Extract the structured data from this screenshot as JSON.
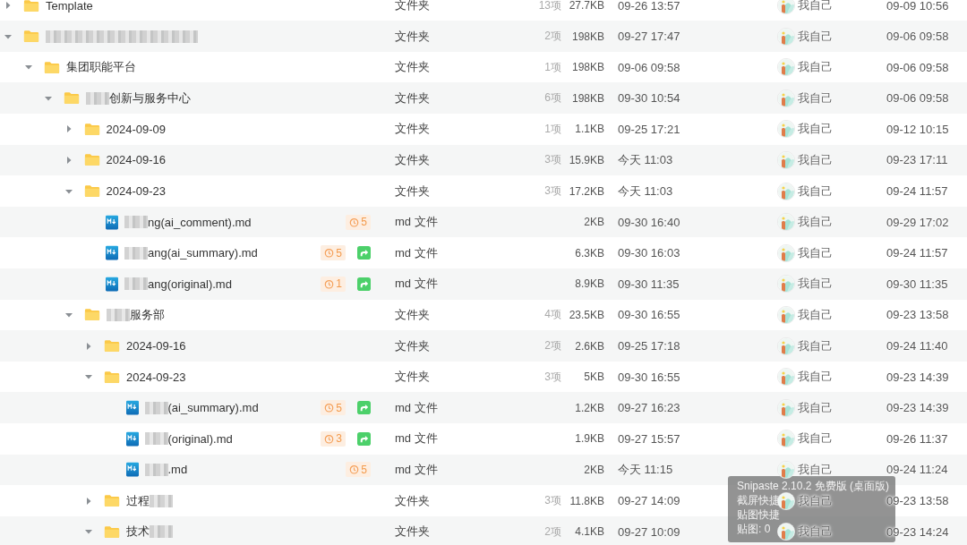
{
  "rows": [
    {
      "kind": "folder",
      "name": "Template",
      "expanded": false,
      "type": "文件夹",
      "count": "13项",
      "size": "27.7KB",
      "modified": "09-26 13:57",
      "owner": "我自己",
      "created": "09-09 10:56"
    },
    {
      "kind": "folder",
      "blurred": true,
      "expanded": true,
      "type": "文件夹",
      "count": "2项",
      "size": "198KB",
      "modified": "09-27 17:47",
      "owner": "我自己",
      "created": "09-06 09:58",
      "children": [
        {
          "kind": "folder",
          "name": "集团职能平台",
          "expanded": true,
          "type": "文件夹",
          "count": "1项",
          "size": "198KB",
          "modified": "09-06 09:58",
          "owner": "我自己",
          "created": "09-06 09:58",
          "children": [
            {
              "kind": "folder",
              "name": "创新与服务中心",
              "blur_before": true,
              "expanded": true,
              "type": "文件夹",
              "count": "6项",
              "size": "198KB",
              "modified": "09-30 10:54",
              "owner": "我自己",
              "created": "09-06 09:58",
              "children": [
                {
                  "kind": "folder",
                  "name": "2024-09-09",
                  "expanded": false,
                  "type": "文件夹",
                  "count": "1项",
                  "size": "1.1KB",
                  "modified": "09-25 17:21",
                  "owner": "我自己",
                  "created": "09-12 10:15"
                },
                {
                  "kind": "folder",
                  "name": "2024-09-16",
                  "expanded": false,
                  "type": "文件夹",
                  "count": "3项",
                  "size": "15.9KB",
                  "modified": "今天 11:03",
                  "owner": "我自己",
                  "created": "09-23 17:11"
                },
                {
                  "kind": "folder",
                  "name": "2024-09-23",
                  "expanded": true,
                  "type": "文件夹",
                  "count": "3项",
                  "size": "17.2KB",
                  "modified": "今天 11:03",
                  "owner": "我自己",
                  "created": "09-24 11:57",
                  "children": [
                    {
                      "kind": "md",
                      "name": "ng(ai_comment).md",
                      "blur_before": true,
                      "history": "5",
                      "shared": false,
                      "type": "md 文件",
                      "size": "2KB",
                      "modified": "09-30 16:40",
                      "owner": "我自己",
                      "created": "09-29 17:02"
                    },
                    {
                      "kind": "md",
                      "name": "ang(ai_summary).md",
                      "blur_before": true,
                      "history": "5",
                      "shared": true,
                      "type": "md 文件",
                      "size": "6.3KB",
                      "modified": "09-30 16:03",
                      "owner": "我自己",
                      "created": "09-24 11:57"
                    },
                    {
                      "kind": "md",
                      "name": "ang(original).md",
                      "blur_before": true,
                      "history": "1",
                      "shared": true,
                      "type": "md 文件",
                      "size": "8.9KB",
                      "modified": "09-30 11:35",
                      "owner": "我自己",
                      "created": "09-30 11:35"
                    }
                  ]
                },
                {
                  "kind": "folder",
                  "name": "服务部",
                  "blur_before": true,
                  "expanded": true,
                  "type": "文件夹",
                  "count": "4项",
                  "size": "23.5KB",
                  "modified": "09-30 16:55",
                  "owner": "我自己",
                  "created": "09-23 13:58",
                  "children": [
                    {
                      "kind": "folder",
                      "name": "2024-09-16",
                      "expanded": false,
                      "type": "文件夹",
                      "count": "2项",
                      "size": "2.6KB",
                      "modified": "09-25 17:18",
                      "owner": "我自己",
                      "created": "09-24 11:40"
                    },
                    {
                      "kind": "folder",
                      "name": "2024-09-23",
                      "expanded": true,
                      "type": "文件夹",
                      "count": "3项",
                      "size": "5KB",
                      "modified": "09-30 16:55",
                      "owner": "我自己",
                      "created": "09-23 14:39",
                      "children": [
                        {
                          "kind": "md",
                          "name": "(ai_summary).md",
                          "blur_before": true,
                          "history": "5",
                          "shared": true,
                          "type": "md 文件",
                          "size": "1.2KB",
                          "modified": "09-27 16:23",
                          "owner": "我自己",
                          "created": "09-23 14:39"
                        },
                        {
                          "kind": "md",
                          "name": "(original).md",
                          "blur_before": true,
                          "history": "3",
                          "shared": true,
                          "type": "md 文件",
                          "size": "1.9KB",
                          "modified": "09-27 15:57",
                          "owner": "我自己",
                          "created": "09-26 11:37"
                        },
                        {
                          "kind": "md",
                          "name": ".md",
                          "blur_before": true,
                          "history": "5",
                          "shared": false,
                          "type": "md 文件",
                          "size": "2KB",
                          "modified": "今天 11:15",
                          "owner": "我自己",
                          "created": "09-24 11:24"
                        }
                      ]
                    },
                    {
                      "kind": "folder",
                      "name": "过程",
                      "blur_after": true,
                      "expanded": false,
                      "type": "文件夹",
                      "count": "3项",
                      "size": "11.8KB",
                      "modified": "09-27 14:09",
                      "owner": "我自己",
                      "created": "09-23 13:58"
                    },
                    {
                      "kind": "folder",
                      "name": "技术",
                      "blur_after": true,
                      "expanded": true,
                      "type": "文件夹",
                      "count": "2项",
                      "size": "4.1KB",
                      "modified": "09-27 10:09",
                      "owner": "我自己",
                      "created": "09-23 14:24"
                    }
                  ]
                }
              ]
            }
          ]
        }
      ]
    }
  ],
  "tooltip": {
    "lines": [
      "Snipaste 2.10.2 免费版 (桌面版)",
      "截屏快捷",
      "贴图快捷",
      "贴图: 0"
    ]
  }
}
